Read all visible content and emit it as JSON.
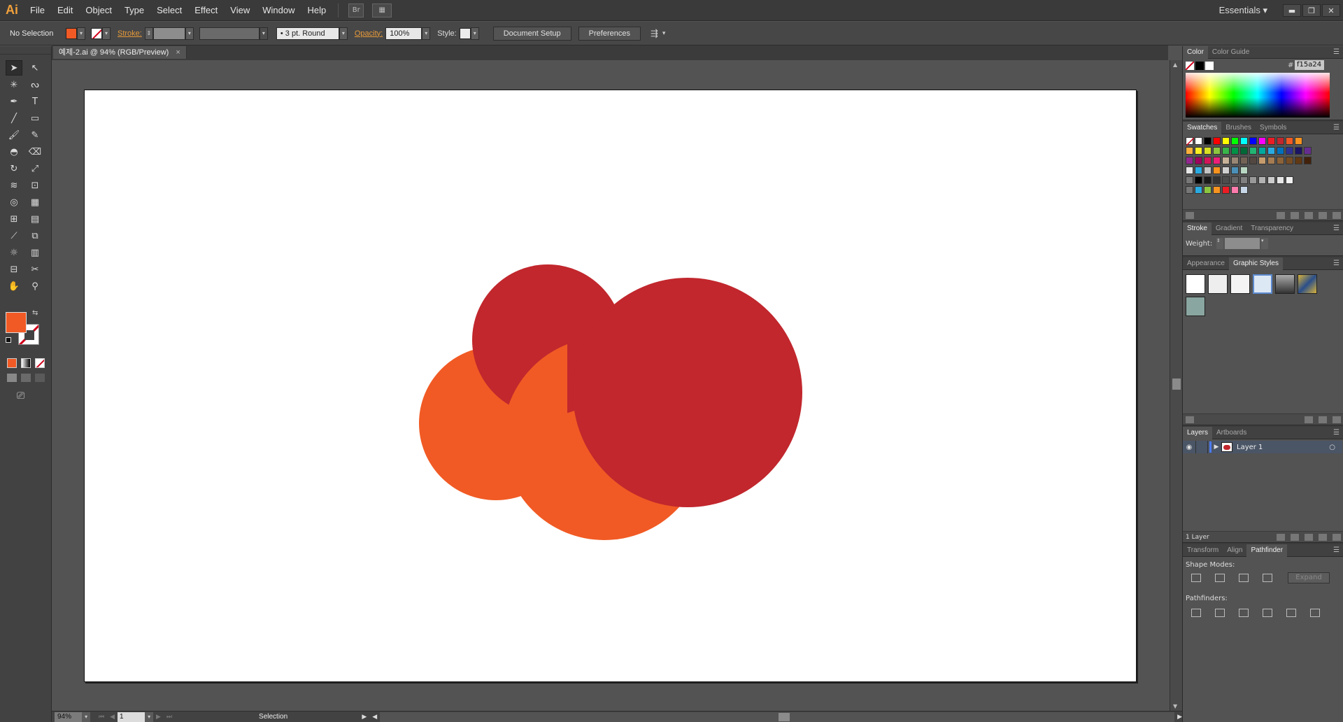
{
  "app": {
    "logo": "Ai"
  },
  "menu": [
    "File",
    "Edit",
    "Object",
    "Type",
    "Select",
    "Effect",
    "View",
    "Window",
    "Help"
  ],
  "menubar_icons": {
    "bridge": "Br",
    "arrange": "▦"
  },
  "workspace": {
    "label": "Essentials",
    "arrow": "▾"
  },
  "window_controls": {
    "minimize": "▬",
    "restore": "❐",
    "close": "✕"
  },
  "control": {
    "selection_label": "No Selection",
    "stroke_label": "Stroke:",
    "brush_value": "3 pt. Round",
    "brush_bullet": "•",
    "opacity_label": "Opacity:",
    "opacity_value": "100%",
    "style_label": "Style:",
    "document_setup": "Document Setup",
    "preferences": "Preferences",
    "arrange_icon": "⇶"
  },
  "document_tab": {
    "title": "예제-2.ai @ 94% (RGB/Preview)",
    "close": "×"
  },
  "colors": {
    "fill": "#f15a24",
    "red": "#c1272d",
    "orange": "#f15a24"
  },
  "status": {
    "zoom": "94%",
    "page": "1",
    "mode": "Selection",
    "first": "⏮",
    "prev": "◀",
    "next": "▶",
    "last": "⏭",
    "scroll_left": "◀",
    "scroll_right": "▶"
  },
  "panels": {
    "menu_icon": "☰",
    "color": {
      "tabs": [
        "Color",
        "Color Guide"
      ],
      "hex_label": "#",
      "hex": "f15a24"
    },
    "swatches": {
      "tabs": [
        "Swatches",
        "Brushes",
        "Symbols"
      ]
    },
    "stroke": {
      "tabs": [
        "Stroke",
        "Gradient",
        "Transparency"
      ],
      "weight_label": "Weight:"
    },
    "appearance": {
      "tabs": [
        "Appearance",
        "Graphic Styles"
      ]
    },
    "layers": {
      "tabs": [
        "Layers",
        "Artboards"
      ],
      "layer_name": "Layer 1",
      "footer": "1 Layer"
    },
    "pathfinder": {
      "tabs": [
        "Transform",
        "Align",
        "Pathfinder"
      ],
      "shape_modes": "Shape Modes:",
      "expand": "Expand",
      "pathfinders": "Pathfinders:"
    }
  },
  "tools": [
    {
      "name": "selection-tool",
      "glyph": "➤"
    },
    {
      "name": "direct-selection-tool",
      "glyph": "↖"
    },
    {
      "name": "magic-wand-tool",
      "glyph": "✳"
    },
    {
      "name": "lasso-tool",
      "glyph": "ᔓ"
    },
    {
      "name": "pen-tool",
      "glyph": "✒"
    },
    {
      "name": "type-tool",
      "glyph": "T"
    },
    {
      "name": "line-tool",
      "glyph": "╱"
    },
    {
      "name": "rectangle-tool",
      "glyph": "▭"
    },
    {
      "name": "paintbrush-tool",
      "glyph": "🖌"
    },
    {
      "name": "pencil-tool",
      "glyph": "✎"
    },
    {
      "name": "blob-brush-tool",
      "glyph": "◓"
    },
    {
      "name": "eraser-tool",
      "glyph": "⌫"
    },
    {
      "name": "rotate-tool",
      "glyph": "↻"
    },
    {
      "name": "scale-tool",
      "glyph": "⤢"
    },
    {
      "name": "warp-tool",
      "glyph": "≋"
    },
    {
      "name": "free-transform-tool",
      "glyph": "⊡"
    },
    {
      "name": "shape-builder-tool",
      "glyph": "◎"
    },
    {
      "name": "perspective-grid-tool",
      "glyph": "▦"
    },
    {
      "name": "mesh-tool",
      "glyph": "⊞"
    },
    {
      "name": "gradient-tool",
      "glyph": "▤"
    },
    {
      "name": "eyedropper-tool",
      "glyph": "⟋"
    },
    {
      "name": "blend-tool",
      "glyph": "⧉"
    },
    {
      "name": "symbol-sprayer-tool",
      "glyph": "☼"
    },
    {
      "name": "column-graph-tool",
      "glyph": "▥"
    },
    {
      "name": "artboard-tool",
      "glyph": "⊟"
    },
    {
      "name": "slice-tool",
      "glyph": "✂"
    },
    {
      "name": "hand-tool",
      "glyph": "✋"
    },
    {
      "name": "zoom-tool",
      "glyph": "⚲"
    }
  ],
  "toolbox_extras": {
    "swap": "⇆",
    "screen_mode": "⎚"
  }
}
